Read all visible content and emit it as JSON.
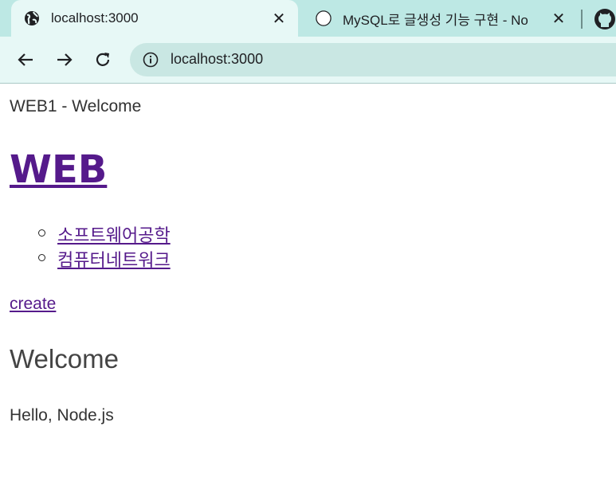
{
  "browser": {
    "tabs": [
      {
        "title": "localhost:3000",
        "active": true,
        "favicon": "globe-icon"
      },
      {
        "title": "MySQL로 글생성 기능 구현 - No",
        "active": false,
        "favicon": "loading-circle-icon"
      }
    ],
    "address_bar": {
      "url": "localhost:3000",
      "icon": "info-icon"
    },
    "colors": {
      "tabbar": "#bde8e4",
      "toolbar": "#e7f8f6",
      "omnibox": "#c9e7e3"
    }
  },
  "page": {
    "document_title": "WEB1 - Welcome",
    "heading_link": "WEB",
    "topics": [
      {
        "label": "소프트웨어공학"
      },
      {
        "label": "컴퓨터네트워크"
      }
    ],
    "create_link": "create",
    "section_title": "Welcome",
    "description": "Hello, Node.js",
    "link_color": "#551a8b"
  }
}
